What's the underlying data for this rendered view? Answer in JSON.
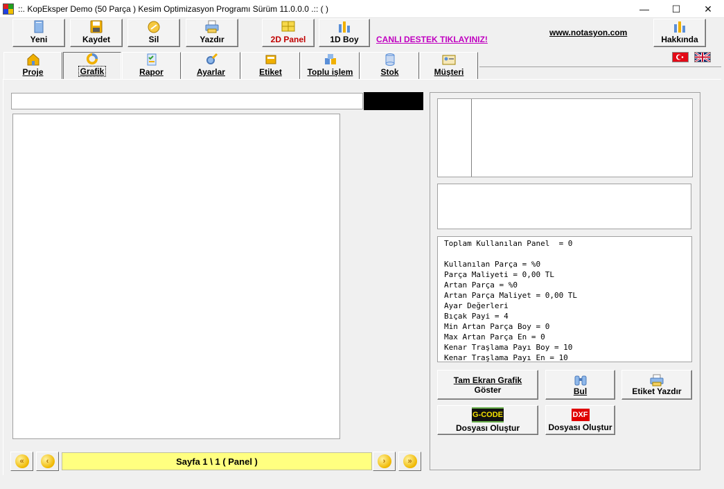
{
  "window": {
    "title": "::. KopEksper Demo (50 Parça ) Kesim Optimizasyon Programı Sürüm 11.0.0.0 .::  ( )",
    "minimize": "—",
    "maximize": "☐",
    "close": "✕"
  },
  "toolbar": {
    "yeni": "Yeni",
    "kaydet": "Kaydet",
    "sil": "Sil",
    "yazdir": "Yazdır",
    "panel2d": "2D Panel",
    "boy1d": "1D Boy",
    "canli_destek": "CANLI DESTEK TIKLAYINIZ!",
    "website": "www.notasyon.com",
    "hakkinda": "Hakkında"
  },
  "tabs": [
    {
      "label": "Proje"
    },
    {
      "label": "Grafik"
    },
    {
      "label": "Rapor"
    },
    {
      "label": "Ayarlar"
    },
    {
      "label": "Etiket"
    },
    {
      "label": "Toplu işlem"
    },
    {
      "label": "Stok"
    },
    {
      "label": "Müşteri"
    }
  ],
  "pager": {
    "label": "Sayfa 1 \\ 1   ( Panel  )"
  },
  "stats": {
    "lines": [
      "Toplam Kullanılan Panel  = 0",
      "",
      "Kullanılan Parça = %0",
      "Parça Maliyeti = 0,00 TL",
      "Artan Parça = %0",
      "Artan Parça Maliyet = 0,00 TL",
      "Ayar Değerleri",
      "Bıçak Payi = 4",
      "Min Artan Parça Boy = 0",
      "Max Artan Parça En = 0",
      "Kenar Traşlama Payı Boy = 10",
      "Kenar Traşlama Payı En = 10"
    ]
  },
  "actions": {
    "tam_ekran_1": "Tam Ekran Grafik",
    "tam_ekran_2": "Göster",
    "bul": "Bul",
    "etiket_yazdir": "Etiket Yazdır",
    "gcode_badge": "G-CODE",
    "gcode_label": "Dosyası Oluştur",
    "dxf_badge": "DXF",
    "dxf_label": "Dosyası Oluştur"
  },
  "colors": {
    "accent_red": "#c00000",
    "link_magenta": "#c000c0",
    "pager_yellow": "#ffff80"
  }
}
